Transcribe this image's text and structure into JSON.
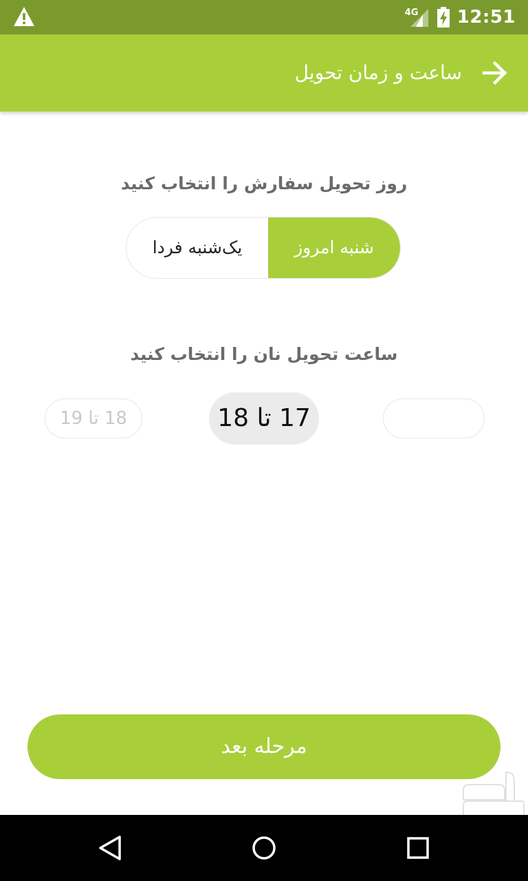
{
  "status_bar": {
    "network": "4G",
    "time": "12:51"
  },
  "app_bar": {
    "title": "ساعت و زمان تحویل",
    "back_icon": "arrow-right-icon"
  },
  "delivery_day": {
    "title": "روز تحویل سفارش  را انتخاب کنید",
    "options": [
      {
        "label": "یک‌شنبه فردا",
        "selected": false
      },
      {
        "label": "شنبه امروز",
        "selected": true
      }
    ]
  },
  "delivery_time": {
    "title": "ساعت تحویل نان را انتخاب کنید",
    "slots": [
      {
        "label": "18 تا 19",
        "state": "disabled"
      },
      {
        "label": "17 تا 18",
        "state": "selected"
      },
      {
        "label": "",
        "state": "empty"
      }
    ]
  },
  "next_button": {
    "label": "مرحله بعد"
  },
  "colors": {
    "status_bar": "#7a9a2e",
    "accent": "#a8cf3a",
    "title_text": "#6b6b6b",
    "selected_slot_bg": "#ebebeb"
  }
}
